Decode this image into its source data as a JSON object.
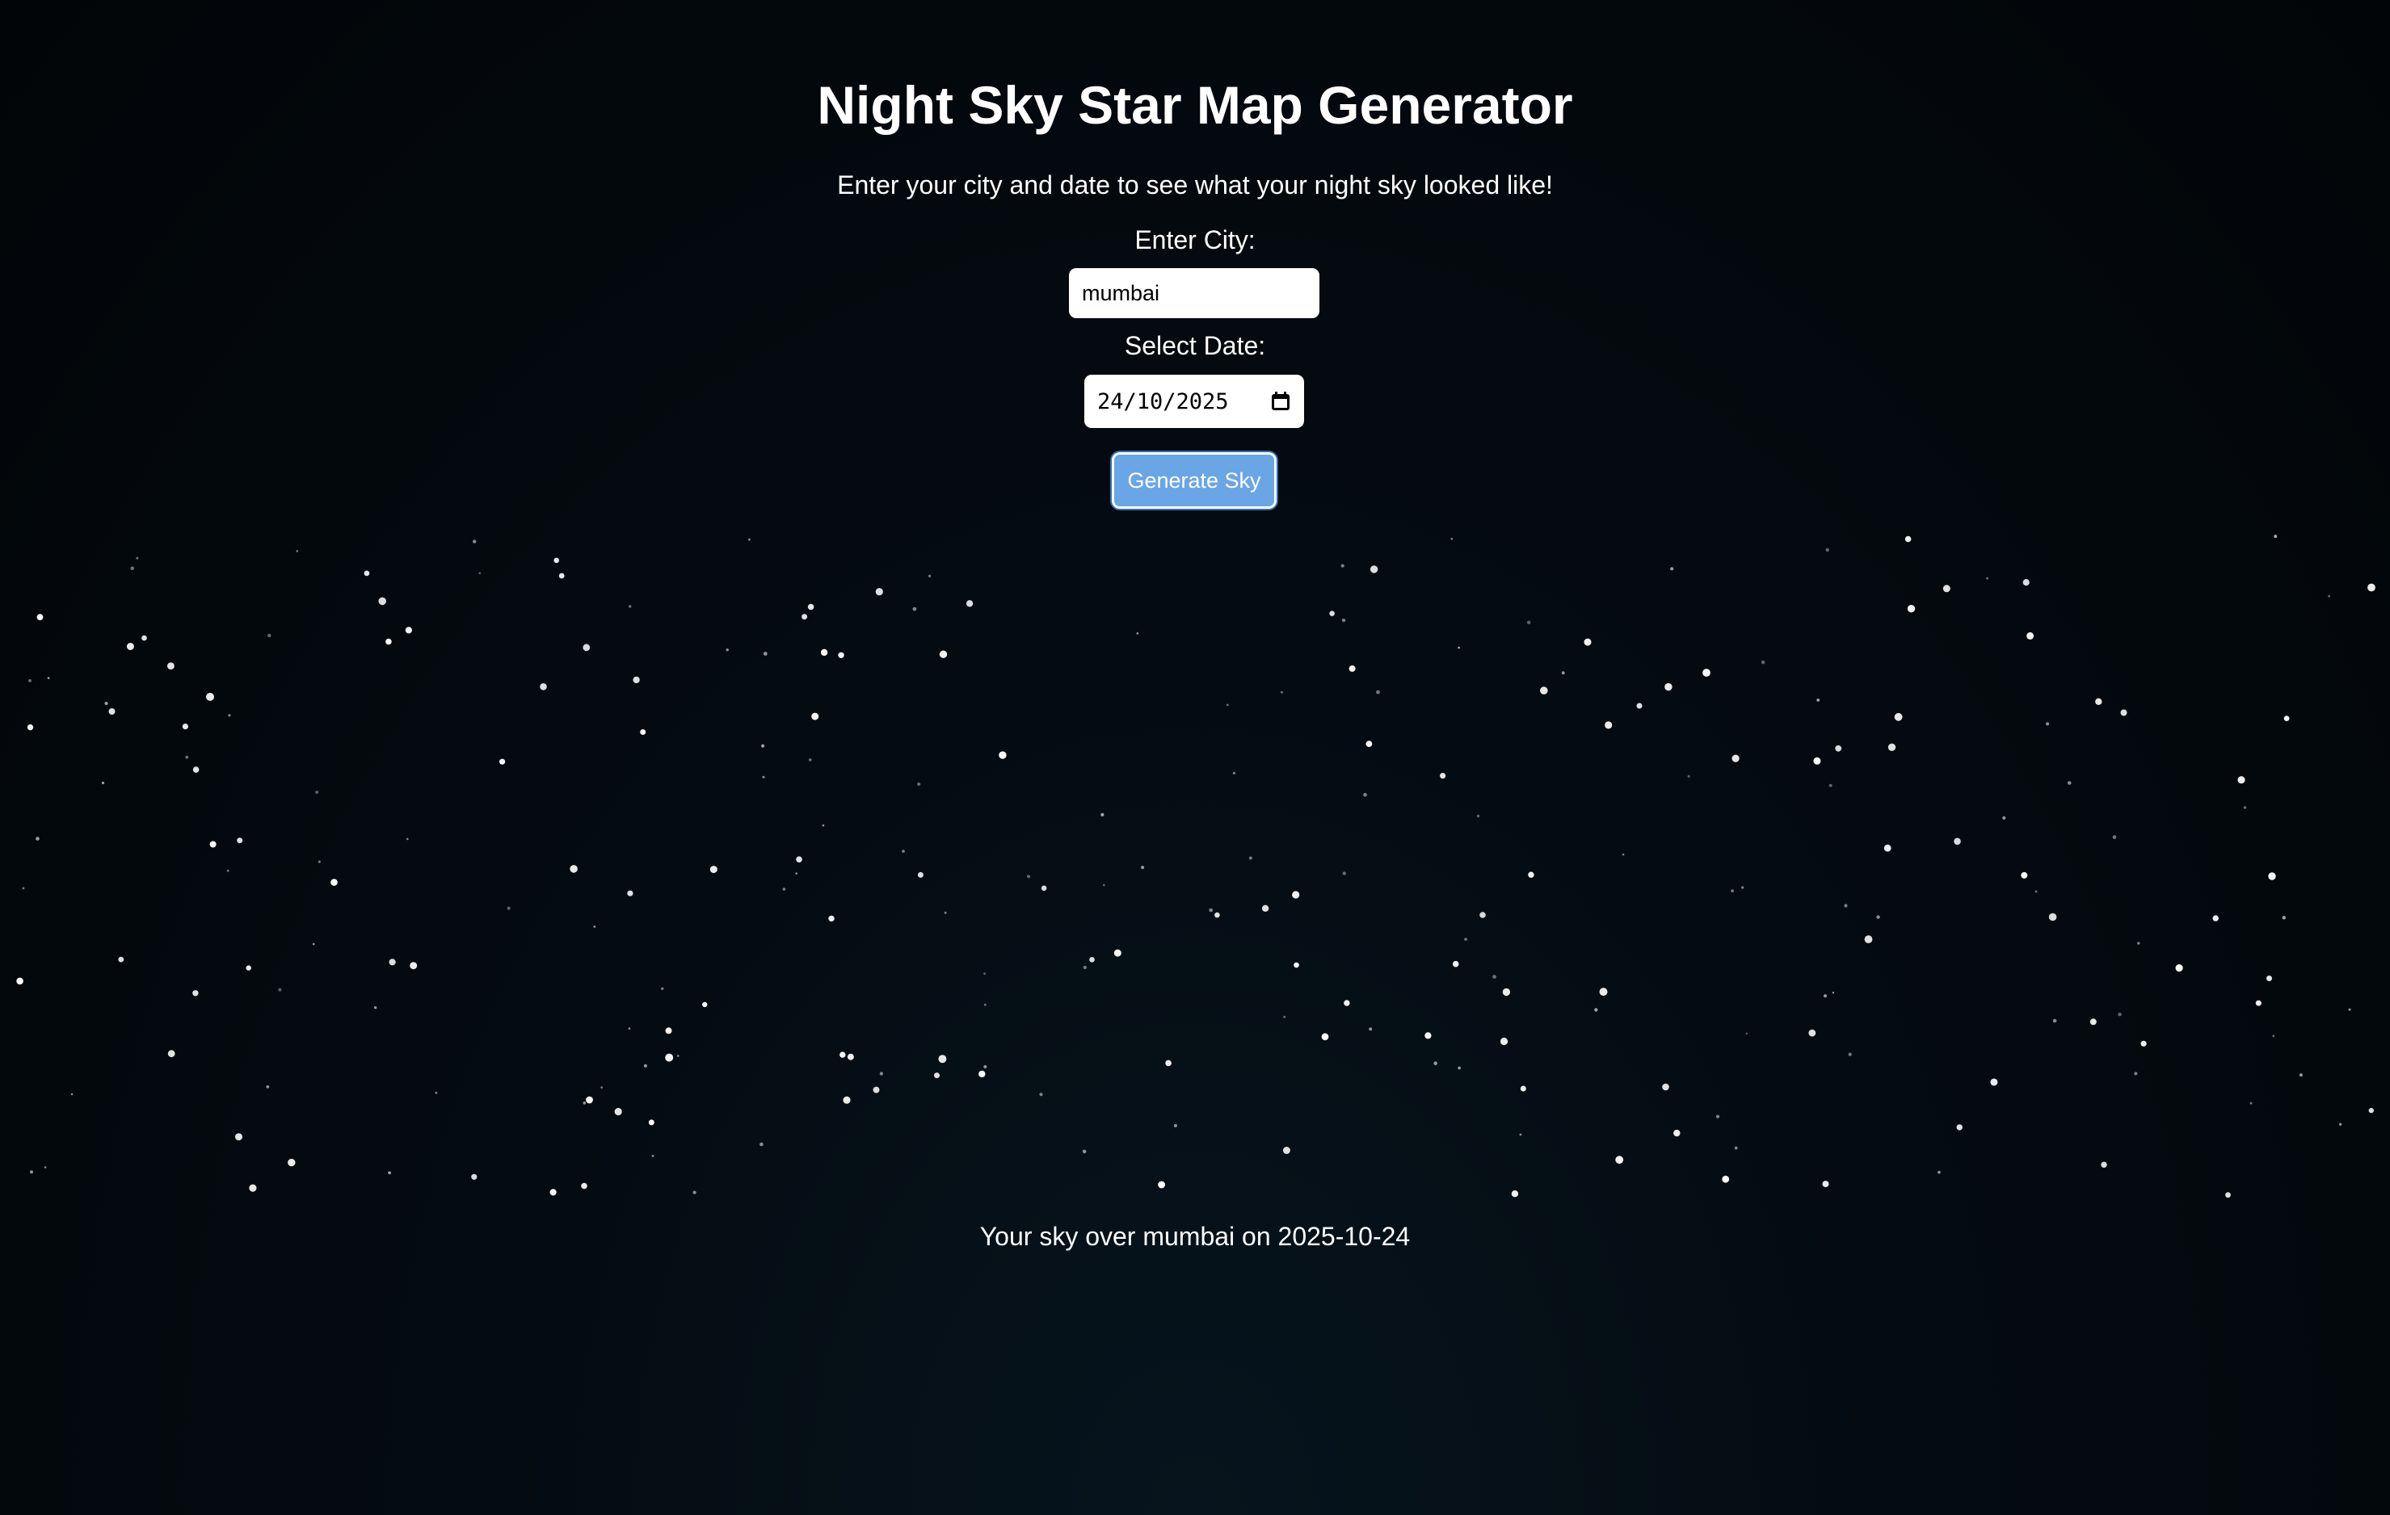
{
  "header": {
    "title": "Night Sky Star Map Generator",
    "subtitle": "Enter your city and date to see what your night sky looked like!"
  },
  "form": {
    "city_label": "Enter City:",
    "city_value": "mumbai",
    "date_label": "Select Date:",
    "date_value": "24/10/2025",
    "generate_label": "Generate Sky"
  },
  "result": {
    "caption": "Your sky over mumbai on 2025-10-24"
  },
  "icons": {
    "date_picker": "calendar-icon"
  },
  "colors": {
    "background": "#03080c",
    "button": "#6aa5e6",
    "star": "#ffffff"
  }
}
